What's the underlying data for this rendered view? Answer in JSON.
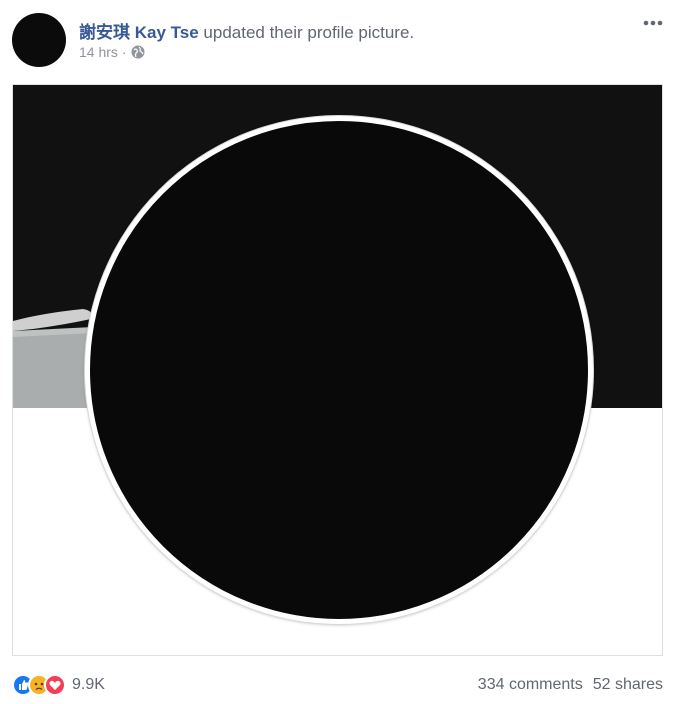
{
  "post": {
    "author": "謝安琪 Kay Tse",
    "action": "updated their profile picture.",
    "timestamp": "14 hrs",
    "separator": "·",
    "privacy_icon": "globe-icon",
    "menu_icon": "more-options-icon"
  },
  "footer": {
    "reactions": [
      "like-icon",
      "sad-icon",
      "love-icon"
    ],
    "reaction_count": "9.9K",
    "comments": "334 comments",
    "shares": "52 shares"
  },
  "colors": {
    "link_blue": "#385898",
    "meta_gray": "#90949c",
    "like_blue": "#1877f2",
    "love_red": "#f33e58",
    "sad_yellow": "#f7b125"
  }
}
